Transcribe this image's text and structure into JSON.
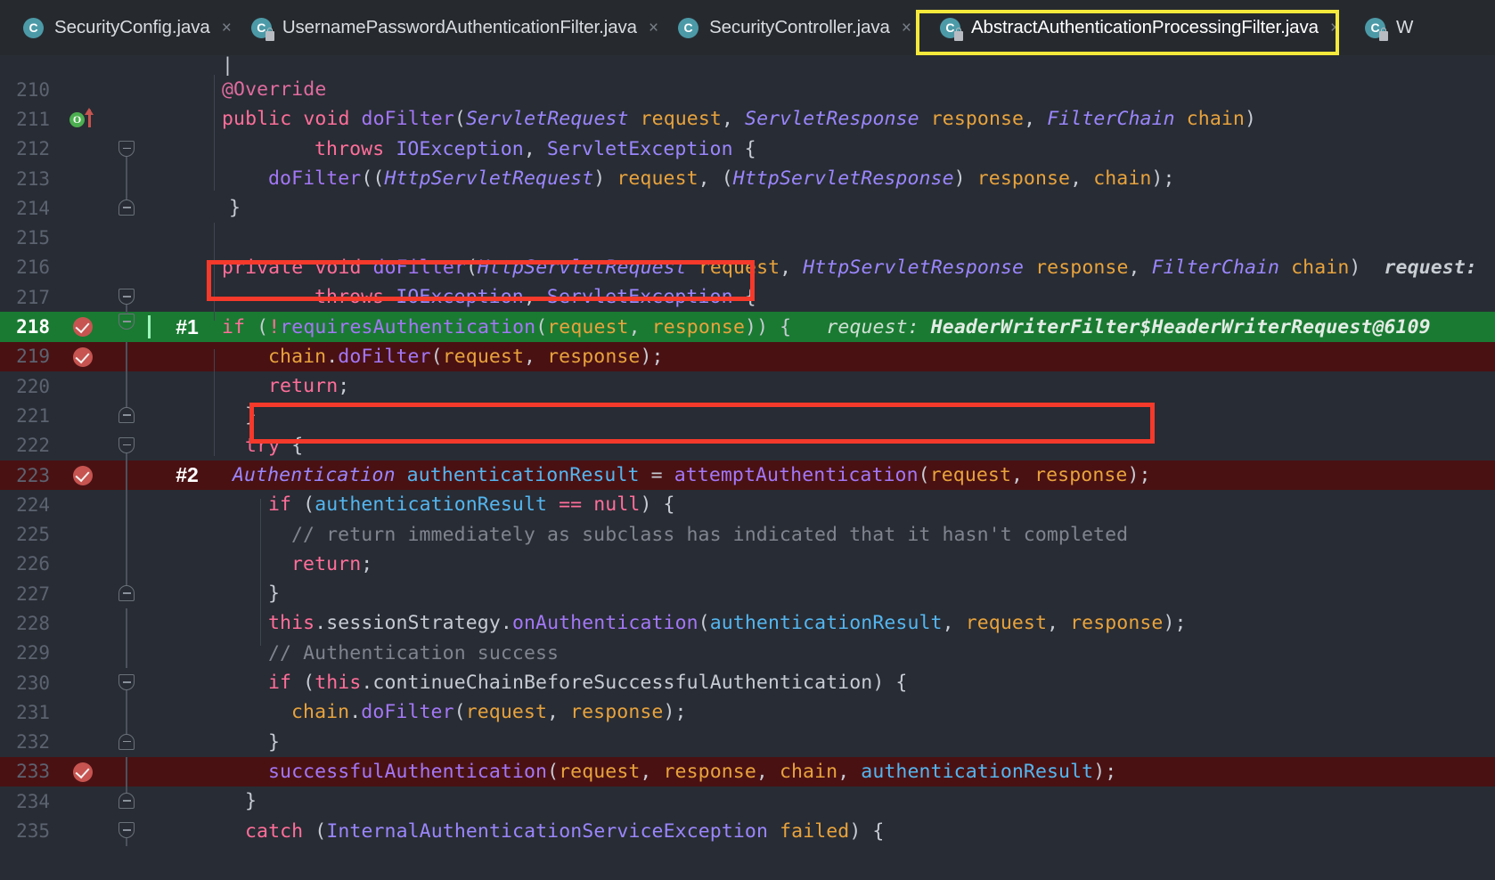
{
  "window": {
    "theme_background": "#282c34",
    "tabbar_background": "#262a2f",
    "accent_highlight": "#f5e93c",
    "annotation_color": "#f5392b",
    "execution_line_color": "#1a7a32",
    "breakpoint_line_color": "#4a1113"
  },
  "tabs": [
    {
      "label": "SecurityConfig.java",
      "icon": "java-class-icon",
      "active": false,
      "close": "×"
    },
    {
      "label": "UsernamePasswordAuthenticationFilter.java",
      "icon": "java-class-locked-icon",
      "active": false,
      "close": "×"
    },
    {
      "label": "SecurityController.java",
      "icon": "java-class-icon",
      "active": false,
      "close": "×"
    },
    {
      "label": "AbstractAuthenticationProcessingFilter.java",
      "icon": "java-class-locked-icon",
      "active": true,
      "close": "×"
    },
    {
      "label": "W",
      "icon": "java-class-locked-icon",
      "active": false,
      "close": ""
    }
  ],
  "annotations": {
    "marker_1": "#1",
    "marker_2": "#2"
  },
  "editor": {
    "inline_hint_216": "request:",
    "inline_hint_218_label": "request:",
    "inline_hint_218_value": "HeaderWriterFilter$HeaderWriterRequest@6109",
    "lines": [
      {
        "n": "210",
        "text": "@Override"
      },
      {
        "n": "211",
        "text": "public void doFilter(ServletRequest request, ServletResponse response, FilterChain chain)"
      },
      {
        "n": "212",
        "text": "throws IOException, ServletException {"
      },
      {
        "n": "213",
        "text": "doFilter((HttpServletRequest) request, (HttpServletResponse) response, chain);"
      },
      {
        "n": "214",
        "text": "}"
      },
      {
        "n": "215",
        "text": ""
      },
      {
        "n": "216",
        "text": "private void doFilter(HttpServletRequest request, HttpServletResponse response, FilterChain chain)"
      },
      {
        "n": "217",
        "text": "throws IOException, ServletException {"
      },
      {
        "n": "218",
        "text": "if (!requiresAuthentication(request, response)) {"
      },
      {
        "n": "219",
        "text": "chain.doFilter(request, response);"
      },
      {
        "n": "220",
        "text": "return;"
      },
      {
        "n": "221",
        "text": "}"
      },
      {
        "n": "222",
        "text": "try {"
      },
      {
        "n": "223",
        "text": "Authentication authenticationResult = attemptAuthentication(request, response);"
      },
      {
        "n": "224",
        "text": "if (authenticationResult == null) {"
      },
      {
        "n": "225",
        "text": "// return immediately as subclass has indicated that it hasn't completed"
      },
      {
        "n": "226",
        "text": "return;"
      },
      {
        "n": "227",
        "text": "}"
      },
      {
        "n": "228",
        "text": "this.sessionStrategy.onAuthentication(authenticationResult, request, response);"
      },
      {
        "n": "229",
        "text": "// Authentication success"
      },
      {
        "n": "230",
        "text": "if (this.continueChainBeforeSuccessfulAuthentication) {"
      },
      {
        "n": "231",
        "text": "chain.doFilter(request, response);"
      },
      {
        "n": "232",
        "text": "}"
      },
      {
        "n": "233",
        "text": "successfulAuthentication(request, response, chain, authenticationResult);"
      },
      {
        "n": "234",
        "text": "}"
      },
      {
        "n": "235",
        "text": "catch (InternalAuthenticationServiceException failed) {"
      }
    ],
    "gutter": {
      "override_marker_line": "211",
      "override_glyph": "O",
      "breakpoint_lines": [
        "218",
        "219",
        "223",
        "233"
      ]
    }
  }
}
